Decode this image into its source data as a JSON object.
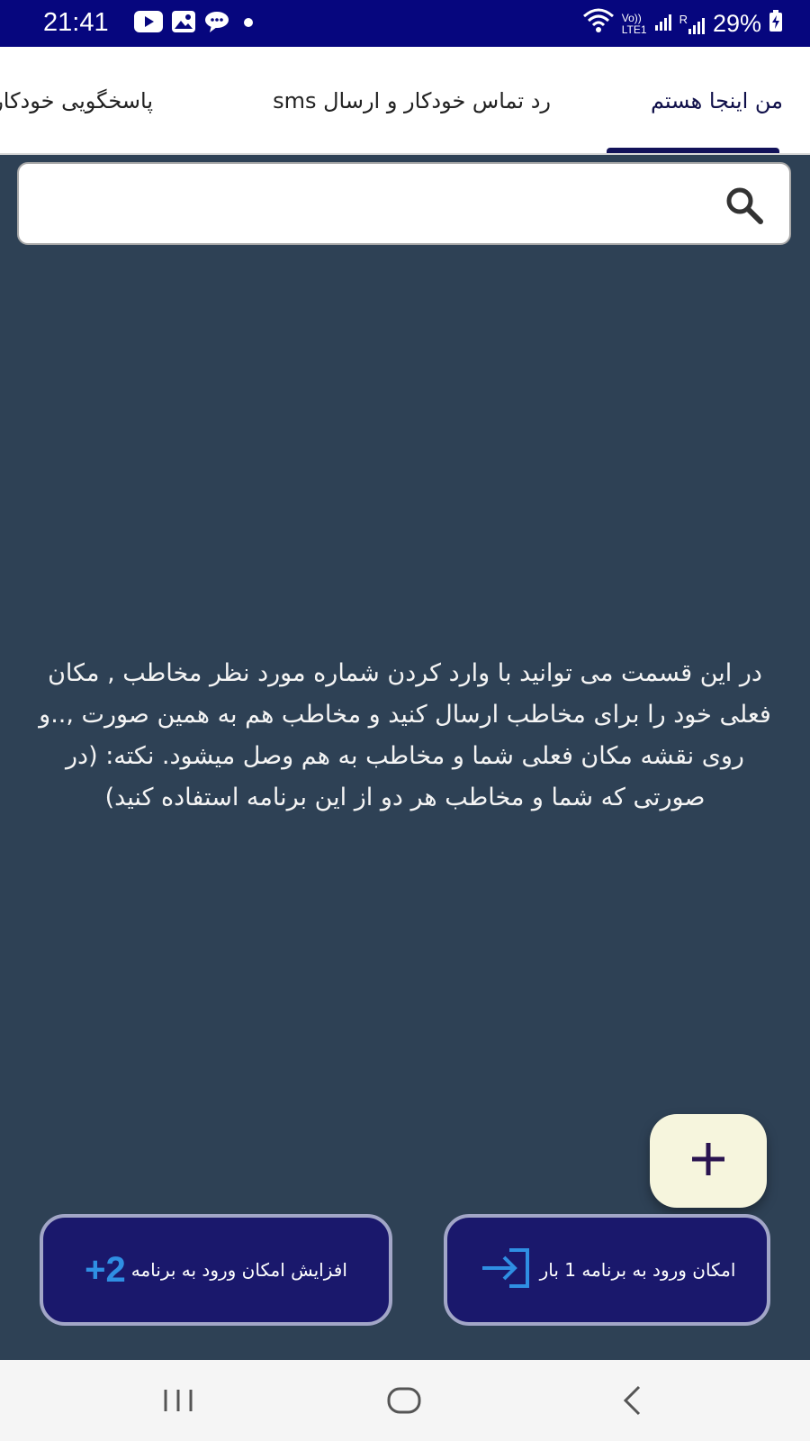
{
  "status_bar": {
    "time": "21:41",
    "notification_icons": [
      "youtube-icon",
      "gallery-icon",
      "chat-icon",
      "dot-icon"
    ],
    "status_icons": [
      "wifi-icon",
      "volte-icon",
      "signal-icon",
      "roaming-signal-icon"
    ],
    "volte_label": "Vo))",
    "lte_label": "LTE1",
    "roaming_label": "R",
    "battery": "29%"
  },
  "tabs": [
    {
      "label": "من اینجا هستم",
      "active": true
    },
    {
      "label": "رد تماس خودکار و ارسال sms",
      "active": false
    },
    {
      "label": "پاسخگویی خودکار",
      "active": false
    }
  ],
  "search": {
    "placeholder": "",
    "value": "",
    "icon": "search-icon"
  },
  "description": "در این قسمت می توانید با وارد کردن شماره مورد نظر مخاطب , مکان فعلی خود را برای مخاطب ارسال کنید و مخاطب هم به همین صورت ,..و روی نقشه مکان فعلی شما و مخاطب به هم وصل میشود. نکته: (در صورتی که شما و مخاطب هر دو از این برنامه استفاده کنید)",
  "fab": {
    "icon": "plus-icon"
  },
  "buttons": {
    "increase_label": "افزایش امکان ورود به برنامه",
    "increase_badge": "+2",
    "login_label": "امکان ورود به برنامه 1 بار",
    "login_icon": "login-icon"
  },
  "nav": [
    "recent-apps-icon",
    "home-icon",
    "back-icon"
  ],
  "colors": {
    "status_bar": "#06067e",
    "background": "#2e4155",
    "button": "#1a186c",
    "button_border": "#a2a6c7",
    "fab": "#f6f5dd",
    "accent_blue": "#2f8fe3"
  }
}
